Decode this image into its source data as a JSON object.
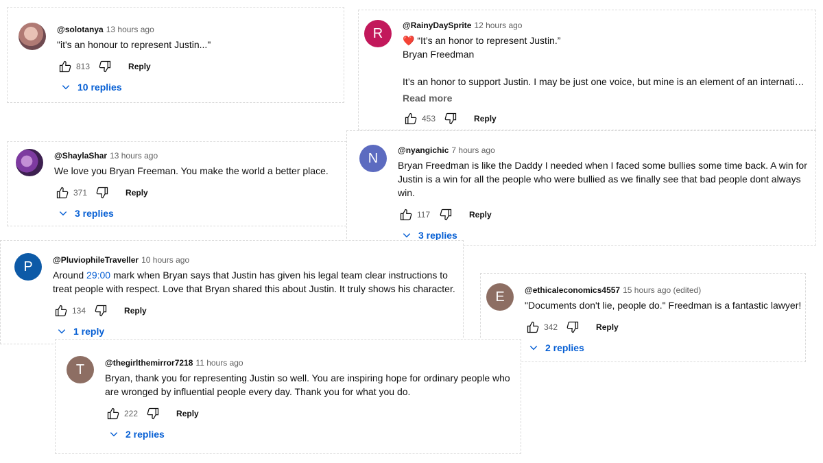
{
  "comments": [
    {
      "id": "c1",
      "author": "@solotanya",
      "time": "13 hours ago",
      "text": "\"it's an honour to represent Justin...\"",
      "likes": "813",
      "reply_label": "Reply",
      "replies_label": "10 replies"
    },
    {
      "id": "c2",
      "author": "@RainyDaySprite",
      "time": "12 hours ago",
      "avatar_letter": "R",
      "avatar_color": "#c2185b",
      "line1": "“It’s an honor to represent Justin.”",
      "line2": "Bryan Freedman",
      "line3": "It’s an honor to support Justin. I may be just one voice, but mine is an element of an internation…",
      "read_more": "Read more",
      "likes": "453",
      "reply_label": "Reply"
    },
    {
      "id": "c3",
      "author": "@ShaylaShar",
      "time": "13 hours ago",
      "text": "We love you Bryan Freeman. You make the world a better place.",
      "likes": "371",
      "reply_label": "Reply",
      "replies_label": "3 replies"
    },
    {
      "id": "c4",
      "author": "@nyangichic",
      "time": "7 hours ago",
      "avatar_letter": "N",
      "avatar_color": "#5c6bc0",
      "text": "Bryan Freedman is like the Daddy I needed when I faced some bullies some time back. A win for Justin is a win for all the people who were bullied as we finally see that bad people dont always win.",
      "likes": "117",
      "reply_label": "Reply",
      "replies_label": "3 replies"
    },
    {
      "id": "c5",
      "author": "@PluviophileTraveller",
      "time": "10 hours ago",
      "avatar_letter": "P",
      "avatar_color": "#0d5aa7",
      "text_pre": "Around ",
      "timestamp_link": "29:00",
      "text_post": " mark when Bryan says that Justin has given his legal team clear instructions to treat people with respect. Love that Bryan shared this about Justin. It truly shows his character.",
      "likes": "134",
      "reply_label": "Reply",
      "replies_label": "1 reply"
    },
    {
      "id": "c6",
      "author": "@ethicaleconomics4557",
      "time": "15 hours ago (edited)",
      "avatar_letter": "E",
      "avatar_color": "#8d6e63",
      "text": "\"Documents don't lie, people do.\" Freedman is a fantastic lawyer!",
      "likes": "342",
      "reply_label": "Reply",
      "replies_label": "2 replies"
    },
    {
      "id": "c7",
      "author": "@thegirlthemirror7218",
      "time": "11 hours ago",
      "avatar_letter": "T",
      "avatar_color": "#8d6e63",
      "text": "Bryan, thank you for representing  Justin so well. You are inspiring hope for ordinary people who are wronged by influential people every day.  Thank you for what you do.",
      "likes": "222",
      "reply_label": "Reply",
      "replies_label": "2 replies"
    }
  ]
}
